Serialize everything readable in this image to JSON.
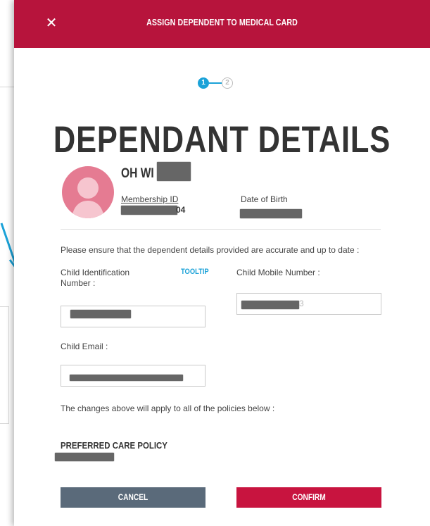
{
  "header": {
    "title": "ASSIGN DEPENDENT TO MEDICAL CARD",
    "close_symbol": "✕"
  },
  "stepper": {
    "current_step": "1",
    "next_step": "2"
  },
  "page_title": "DEPENDANT DETAILS",
  "dependent": {
    "name_visible": "OH WI",
    "membership_id_label": "Membership ID",
    "membership_id_visible": "04",
    "dob_label": "Date of Birth"
  },
  "form": {
    "notice": "Please ensure that the dependent details provided are accurate and up to date :",
    "child_id_label_line1": "Child Identification",
    "child_id_label_line2": "Number :",
    "tooltip_label": "TOOLTIP",
    "child_mobile_label": "Child Mobile Number :",
    "child_mobile_visible_suffix": "3",
    "child_email_label": "Child Email :",
    "policies_notice": "The changes above will apply to all of the policies below :"
  },
  "policy": {
    "name": "PREFERRED CARE POLICY"
  },
  "actions": {
    "cancel_label": "CANCEL",
    "confirm_label": "CONFIRM"
  },
  "colors": {
    "header": "#b7143c",
    "accent": "#1ba2d8",
    "cancel": "#5a6a7a",
    "confirm": "#c8143f",
    "avatar": "#e57b92"
  }
}
